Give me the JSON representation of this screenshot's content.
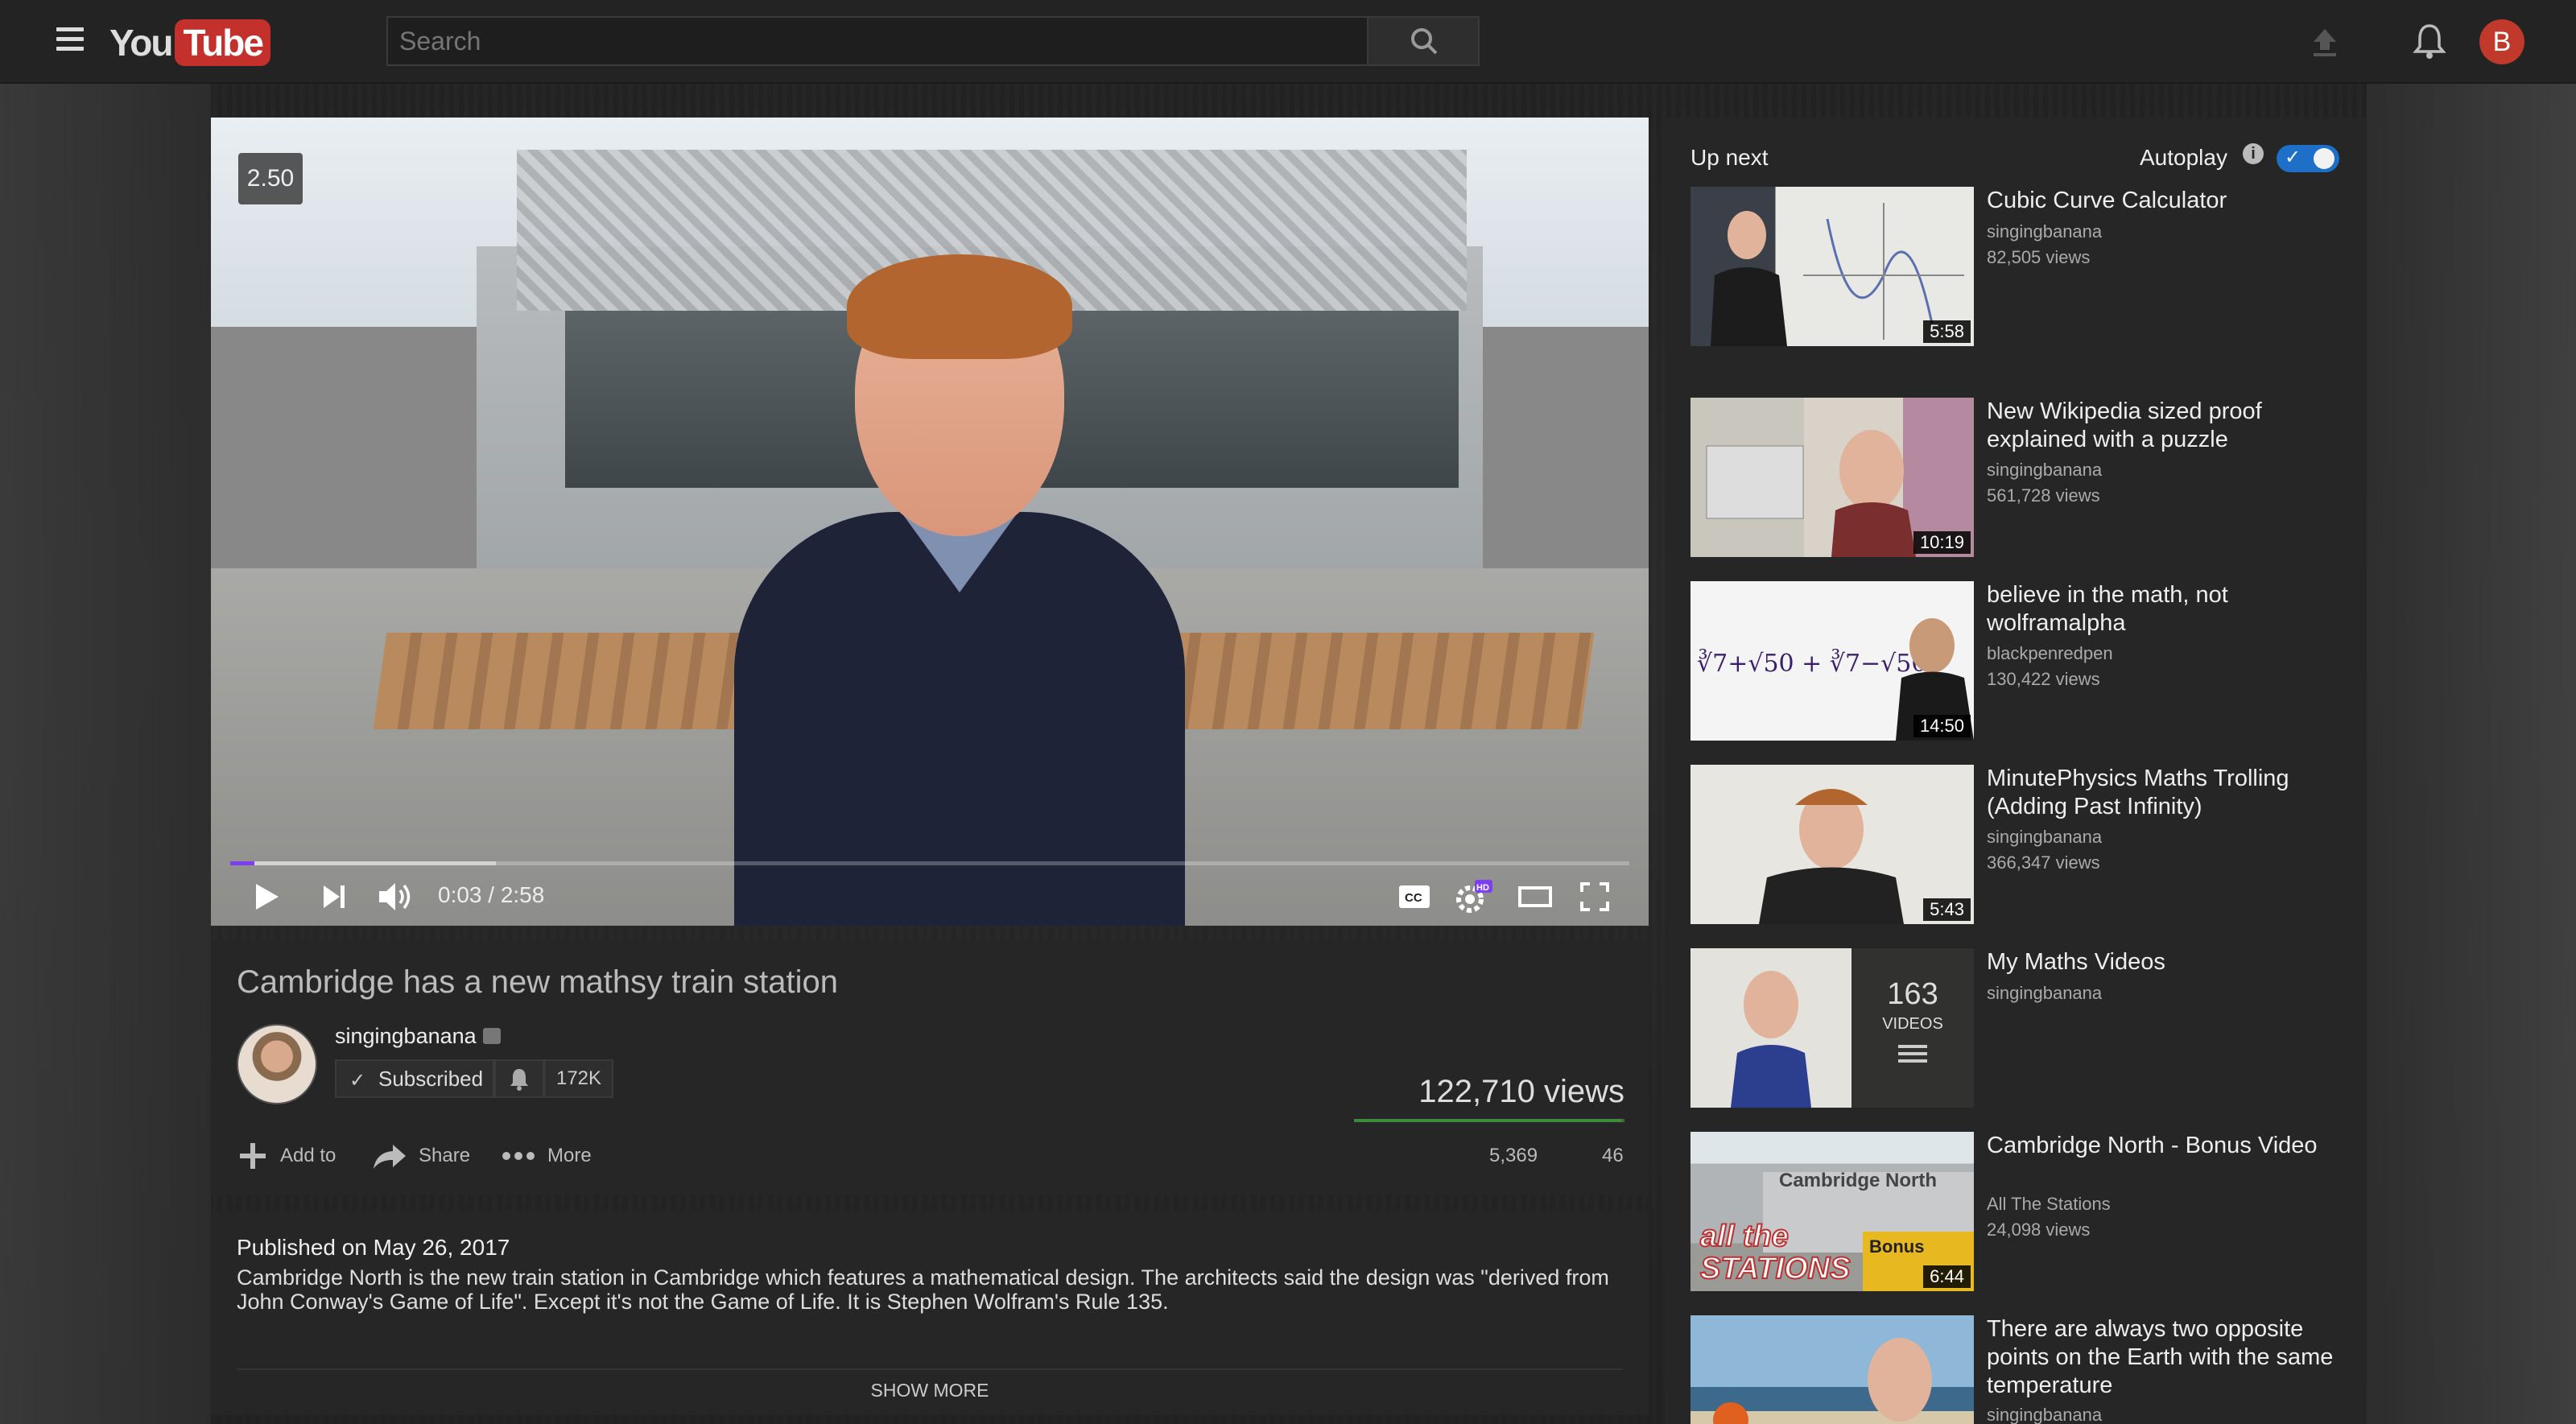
{
  "header": {
    "logo_you": "You",
    "logo_tube": "Tube",
    "search_placeholder": "Search",
    "avatar_letter": "B"
  },
  "player": {
    "playback_rate": "2.50",
    "current_time": "0:03",
    "duration": "2:58",
    "time_display": "0:03 / 2:58",
    "progress_played": 0.017,
    "progress_loaded": 0.19,
    "colors": {
      "progress": "#7e3ff2",
      "accent": "#c4302b"
    },
    "controls": [
      "play-icon",
      "next-icon",
      "volume-icon",
      "captions-icon",
      "settings-hd-icon",
      "theater-icon",
      "fullscreen-icon"
    ],
    "sign_text": "Cambridge North"
  },
  "video": {
    "title": "Cambridge has a new mathsy train station",
    "channel": "singingbanana",
    "subscribe_label": "Subscribed",
    "subscriber_count": "172K",
    "views": "122,710 views",
    "likes": "5,369",
    "dislikes": "46",
    "like_ratio": 0.99,
    "actions": {
      "add_to": "Add to",
      "share": "Share",
      "more": "More"
    }
  },
  "description": {
    "published": "Published on May 26, 2017",
    "text": "Cambridge North is the new train station in Cambridge which features a mathematical design. The architects said the design was \"derived from John Conway's Game of Life\". Except it's not the Game of Life. It is Stephen Wolfram's Rule 135.",
    "show_more": "SHOW MORE"
  },
  "sidebar": {
    "up_next": "Up next",
    "autoplay": "Autoplay",
    "autoplay_on": true,
    "items": [
      {
        "title": "Cubic Curve Calculator",
        "channel": "singingbanana",
        "views": "82,505 views",
        "duration": "5:58"
      },
      {
        "title": "New Wikipedia sized proof explained with a puzzle",
        "channel": "singingbanana",
        "views": "561,728 views",
        "duration": "10:19"
      },
      {
        "title": "believe in the math, not wolframalpha",
        "channel": "blackpenredpen",
        "views": "130,422 views",
        "duration": "14:50"
      },
      {
        "title": "MinutePhysics Maths Trolling (Adding Past Infinity)",
        "channel": "singingbanana",
        "views": "366,347 views",
        "duration": "5:43"
      },
      {
        "title": "My Maths Videos",
        "channel": "singingbanana",
        "playlist_count": "163",
        "playlist_label": "VIDEOS"
      },
      {
        "title": "Cambridge North - Bonus Video",
        "channel": "All The Stations",
        "views": "24,098 views",
        "duration": "6:44"
      },
      {
        "title": "There are always two opposite points on the Earth with the same temperature",
        "channel": "singingbanana"
      }
    ],
    "thumb_texts": {
      "radical_expr": "∛7+√50 + ∛7−√50",
      "all_the": "all the",
      "stations": "STATIONS",
      "bonus": "Bonus",
      "sign": "Cambridge North"
    }
  }
}
